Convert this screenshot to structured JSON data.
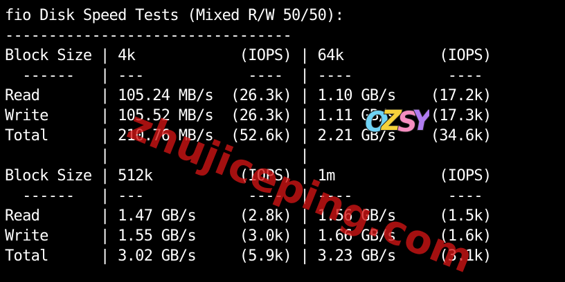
{
  "terminal": {
    "title": "fio Disk Speed Tests (Mixed R/W 50/50):",
    "lines": [
      "fio Disk Speed Tests (Mixed R/W 50/50):",
      "---------------------------------",
      "Block Size | 4k            (IOPS) | 64k           (IOPS)",
      "  ------   | ---            ----  | ----           ----",
      "Read       | 105.24 MB/s  (26.3k) | 1.10 GB/s    (17.2k)",
      "Write      | 105.52 MB/s  (26.3k) | 1.11 GB/s    (17.3k)",
      "Total      | 210.76 MB/s  (52.6k) | 2.21 GB/s    (34.6k)",
      "           |                      |",
      "Block Size | 512k          (IOPS) | 1m            (IOPS)",
      "  ------   | ---            ----  | ----           ----",
      "Read       | 1.47 GB/s     (2.8k) | 1.56 GB/s     (1.5k)",
      "Write      | 1.55 GB/s     (3.0k) | 1.66 GB/s     (1.6k)",
      "Total      | 3.02 GB/s     (5.9k) | 3.23 GB/s     (3.1k)"
    ]
  },
  "watermark": {
    "text": "zhujiceping.com",
    "color": "#d21414"
  },
  "logo": {
    "text": "OZSY",
    "letters": [
      "O",
      "Z",
      "S",
      "Y"
    ],
    "colors": [
      "#6fd3f5",
      "#f6d23b",
      "#f58ec0",
      "#b07cf0"
    ],
    "outline": "#222222"
  }
}
